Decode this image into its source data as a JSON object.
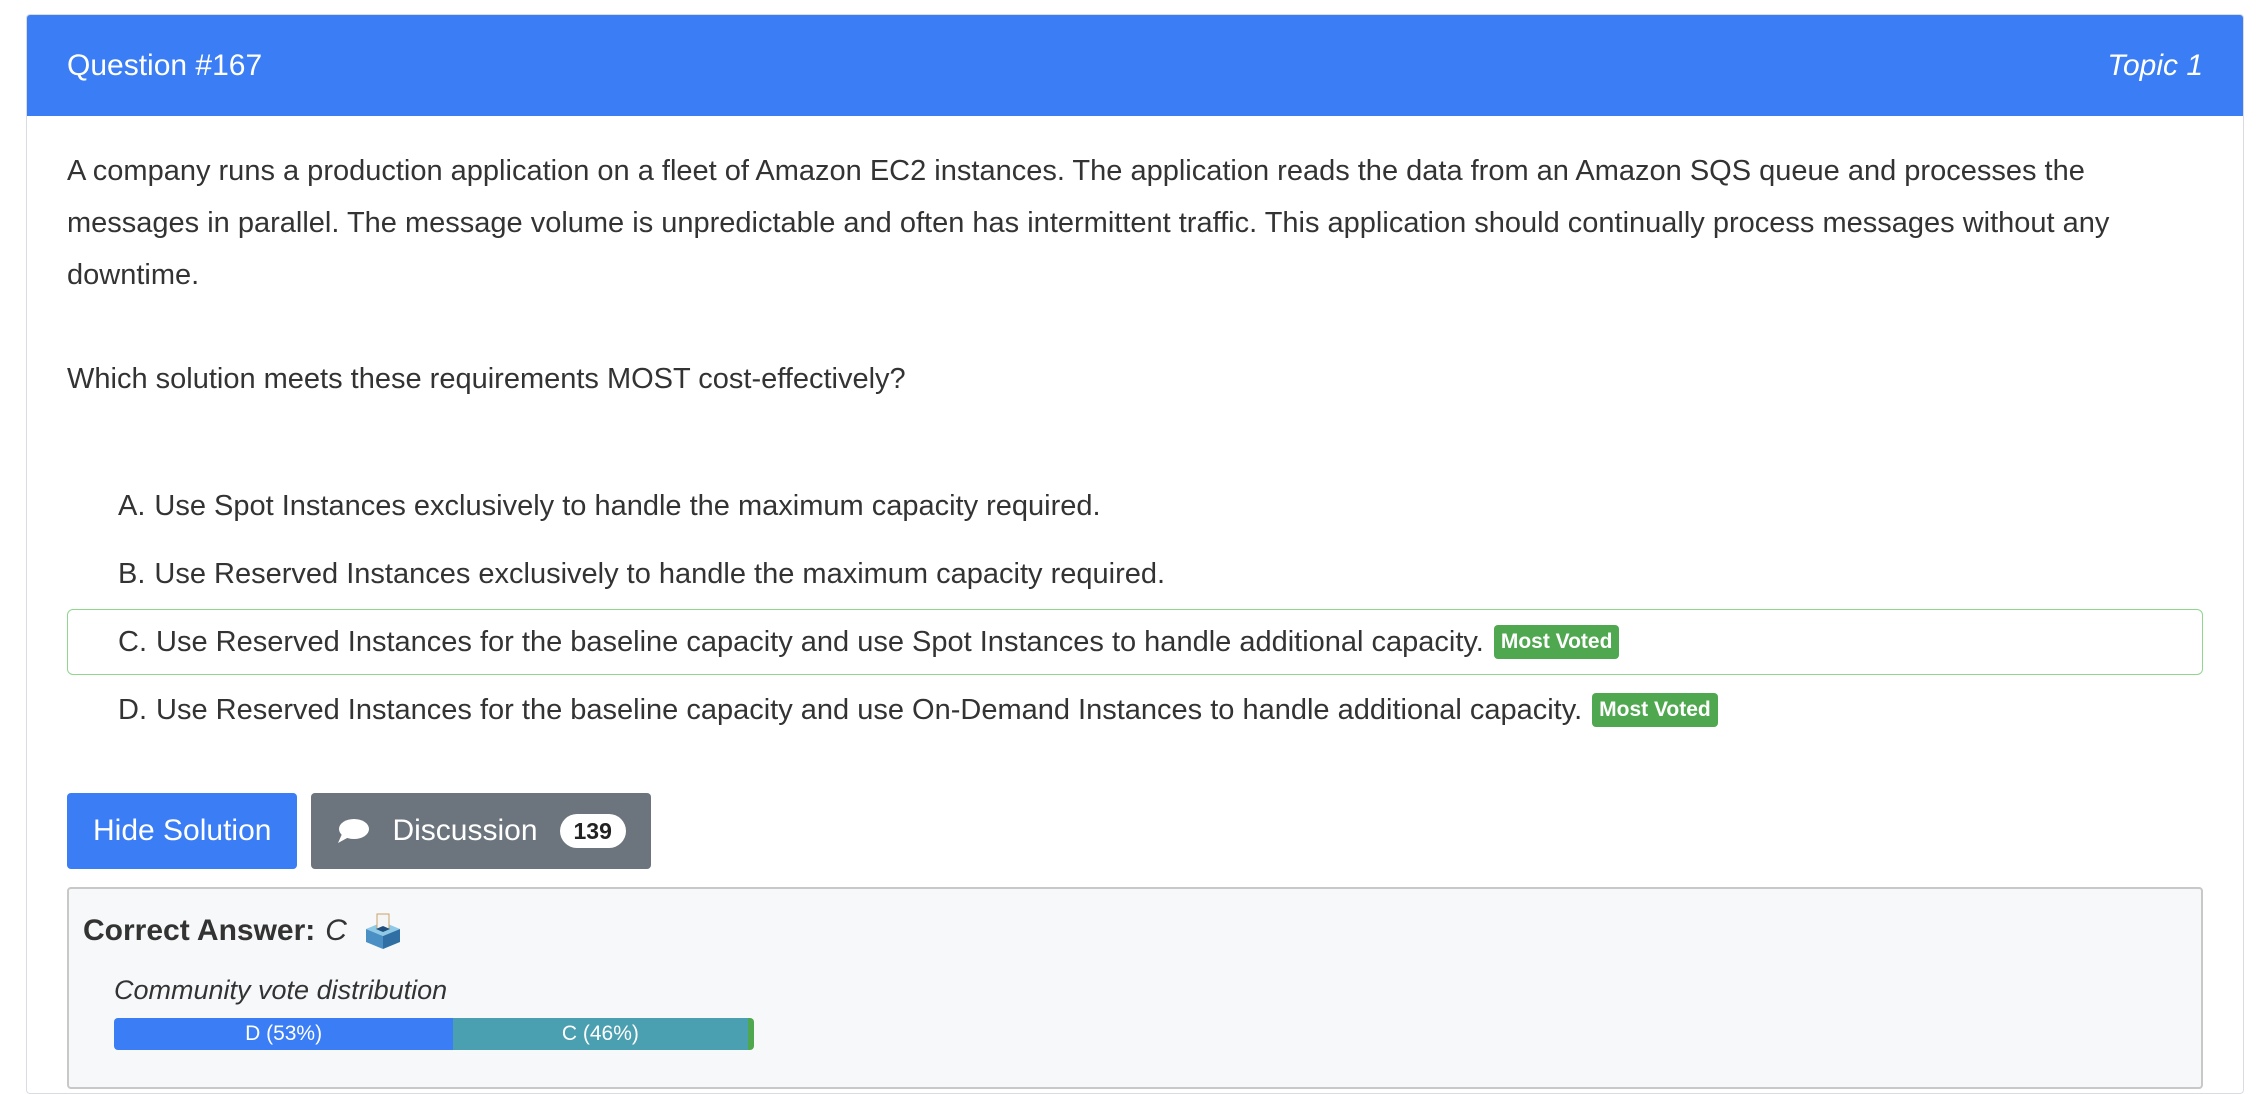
{
  "header": {
    "question_number": "Question #167",
    "topic": "Topic 1"
  },
  "question": {
    "text": "A company runs a production application on a fleet of Amazon EC2 instances. The application reads the data from an Amazon SQS queue and processes the messages in parallel. The message volume is unpredictable and often has intermittent traffic. This application should continually process messages without any downtime.",
    "prompt": "Which solution meets these requirements MOST cost-effectively?"
  },
  "choices": [
    {
      "letter": "A.",
      "text": "Use Spot Instances exclusively to handle the maximum capacity required.",
      "badge": ""
    },
    {
      "letter": "B.",
      "text": "Use Reserved Instances exclusively to handle the maximum capacity required.",
      "badge": ""
    },
    {
      "letter": "C.",
      "text": "Use Reserved Instances for the baseline capacity and use Spot Instances to handle additional capacity.",
      "badge": "Most Voted"
    },
    {
      "letter": "D.",
      "text": "Use Reserved Instances for the baseline capacity and use On-Demand Instances to handle additional capacity.",
      "badge": "Most Voted"
    }
  ],
  "actions": {
    "hide_solution": "Hide Solution",
    "discussion": "Discussion",
    "discussion_count": "139"
  },
  "answer": {
    "label": "Correct Answer:",
    "value": "C",
    "icon": "ballot-box-icon"
  },
  "votes": {
    "title": "Community vote distribution",
    "segments": [
      {
        "label": "D (53%)",
        "percent": 53,
        "color": "#3a7df4"
      },
      {
        "label": "C (46%)",
        "percent": 46,
        "color": "#4a9fb0"
      },
      {
        "label": "",
        "percent": 1,
        "color": "#4fa84f"
      }
    ]
  },
  "colors": {
    "header": "#3a7df4",
    "most_voted_badge": "#4fa84f",
    "correct_border": "#8fd68f",
    "discussion_button": "#6c757d"
  }
}
